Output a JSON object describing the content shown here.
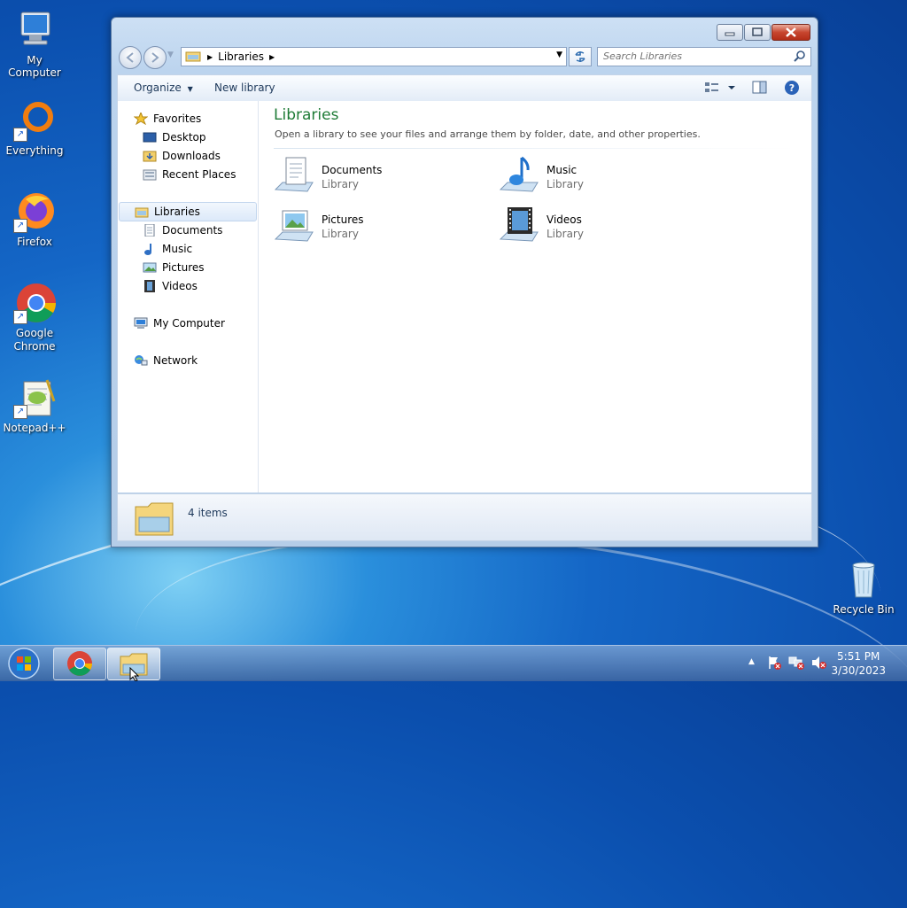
{
  "desktop": {
    "icons": [
      {
        "label": "My Computer",
        "icon": "computer-icon"
      },
      {
        "label": "Everything",
        "icon": "everything-icon"
      },
      {
        "label": "Firefox",
        "icon": "firefox-icon"
      },
      {
        "label": "Google Chrome",
        "icon": "chrome-icon"
      },
      {
        "label": "Notepad++",
        "icon": "notepadpp-icon"
      },
      {
        "label": "Recycle Bin",
        "icon": "recycle-bin-icon"
      }
    ]
  },
  "window": {
    "address": {
      "crumb": "Libraries"
    },
    "search": {
      "placeholder": "Search Libraries"
    },
    "toolbar": {
      "organize": "Organize",
      "new_library": "New library"
    },
    "nav": {
      "favorites": "Favorites",
      "desktop": "Desktop",
      "downloads": "Downloads",
      "recent_places": "Recent Places",
      "libraries": "Libraries",
      "documents": "Documents",
      "music": "Music",
      "pictures": "Pictures",
      "videos": "Videos",
      "my_computer": "My Computer",
      "network": "Network"
    },
    "main": {
      "title": "Libraries",
      "subtitle": "Open a library to see your files and arrange them by folder, date, and other properties.",
      "libraries": [
        {
          "name": "Documents",
          "type": "Library"
        },
        {
          "name": "Music",
          "type": "Library"
        },
        {
          "name": "Pictures",
          "type": "Library"
        },
        {
          "name": "Videos",
          "type": "Library"
        }
      ]
    },
    "details": {
      "count": "4 items"
    }
  },
  "taskbar": {
    "time": "5:51 PM",
    "date": "3/30/2023"
  },
  "colors": {
    "title_green": "#1e7b36",
    "accent_blue": "#1466c6"
  }
}
